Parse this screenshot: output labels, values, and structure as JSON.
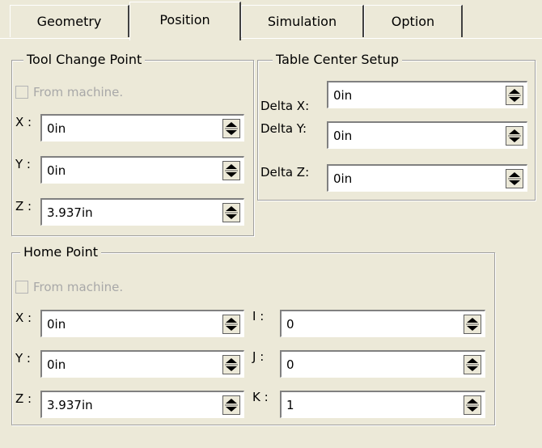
{
  "tabs": [
    {
      "label": "Geometry"
    },
    {
      "label": "Position"
    },
    {
      "label": "Simulation"
    },
    {
      "label": "Option"
    }
  ],
  "active_tab": "Position",
  "tool_change_point": {
    "title": "Tool Change Point",
    "from_machine_label": "From machine.",
    "from_machine_checked": false,
    "fields": [
      {
        "label": "X :",
        "value": "0in"
      },
      {
        "label": "Y :",
        "value": "0in"
      },
      {
        "label": "Z :",
        "value": "3.937in"
      }
    ]
  },
  "table_center_setup": {
    "title": "Table Center Setup",
    "fields": [
      {
        "label": "Delta X:",
        "value": "0in"
      },
      {
        "label": "Delta Y:",
        "value": "0in"
      },
      {
        "label": "Delta Z:",
        "value": "0in"
      }
    ]
  },
  "home_point": {
    "title": "Home Point",
    "from_machine_label": "From machine.",
    "from_machine_checked": false,
    "left_fields": [
      {
        "label": "X :",
        "value": "0in"
      },
      {
        "label": "Y :",
        "value": "0in"
      },
      {
        "label": "Z :",
        "value": "3.937in"
      }
    ],
    "right_fields": [
      {
        "label": "I :",
        "value": "0"
      },
      {
        "label": "J :",
        "value": "0"
      },
      {
        "label": "K :",
        "value": "1"
      }
    ]
  },
  "icons": {
    "spinner": "up-down-spinner-icon"
  }
}
